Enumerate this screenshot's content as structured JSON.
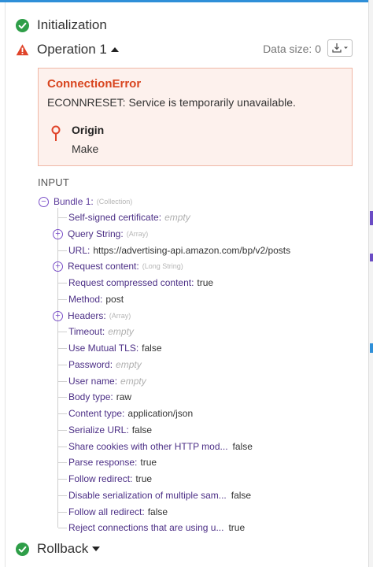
{
  "sections": {
    "initialization": {
      "title": "Initialization",
      "status": "success"
    },
    "operation": {
      "title": "Operation 1",
      "status": "warning",
      "data_size_label": "Data size: 0"
    },
    "rollback": {
      "title": "Rollback",
      "status": "success"
    }
  },
  "error": {
    "title": "ConnectionError",
    "message": "ECONNRESET: Service is temporarily unavailable.",
    "origin_label": "Origin",
    "origin_value": "Make"
  },
  "input": {
    "label": "INPUT",
    "bundle": {
      "key": "Bundle 1:",
      "kind": "(Collection)"
    },
    "items": [
      {
        "key": "Self-signed certificate:",
        "value": "empty"
      },
      {
        "key": "Query String:",
        "kind": "(Array)"
      },
      {
        "key": "URL:",
        "value": "https://advertising-api.amazon.com/bp/v2/posts"
      },
      {
        "key": "Request content:",
        "kind": "(Long String)"
      },
      {
        "key": "Request compressed content:",
        "value": "true"
      },
      {
        "key": "Method:",
        "value": "post"
      },
      {
        "key": "Headers:",
        "kind": "(Array)"
      },
      {
        "key": "Timeout:",
        "value": "empty"
      },
      {
        "key": "Use Mutual TLS:",
        "value": "false"
      },
      {
        "key": "Password:",
        "value": "empty"
      },
      {
        "key": "User name:",
        "value": "empty"
      },
      {
        "key": "Body type:",
        "value": "raw"
      },
      {
        "key": "Content type:",
        "value": "application/json"
      },
      {
        "key": "Serialize URL:",
        "value": "false"
      },
      {
        "key": "Share cookies with other HTTP mod...",
        "value": "false"
      },
      {
        "key": "Parse response:",
        "value": "true"
      },
      {
        "key": "Follow redirect:",
        "value": "true"
      },
      {
        "key": "Disable serialization of multiple sam...",
        "value": "false"
      },
      {
        "key": "Follow all redirect:",
        "value": "false"
      },
      {
        "key": "Reject connections that are using u...",
        "value": "true"
      }
    ]
  },
  "colors": {
    "success": "#2e9e48",
    "warning": "#e0442a",
    "error_text": "#d8451f",
    "key_purple": "#4c2f86",
    "accent_blue": "#2f8fd8"
  }
}
